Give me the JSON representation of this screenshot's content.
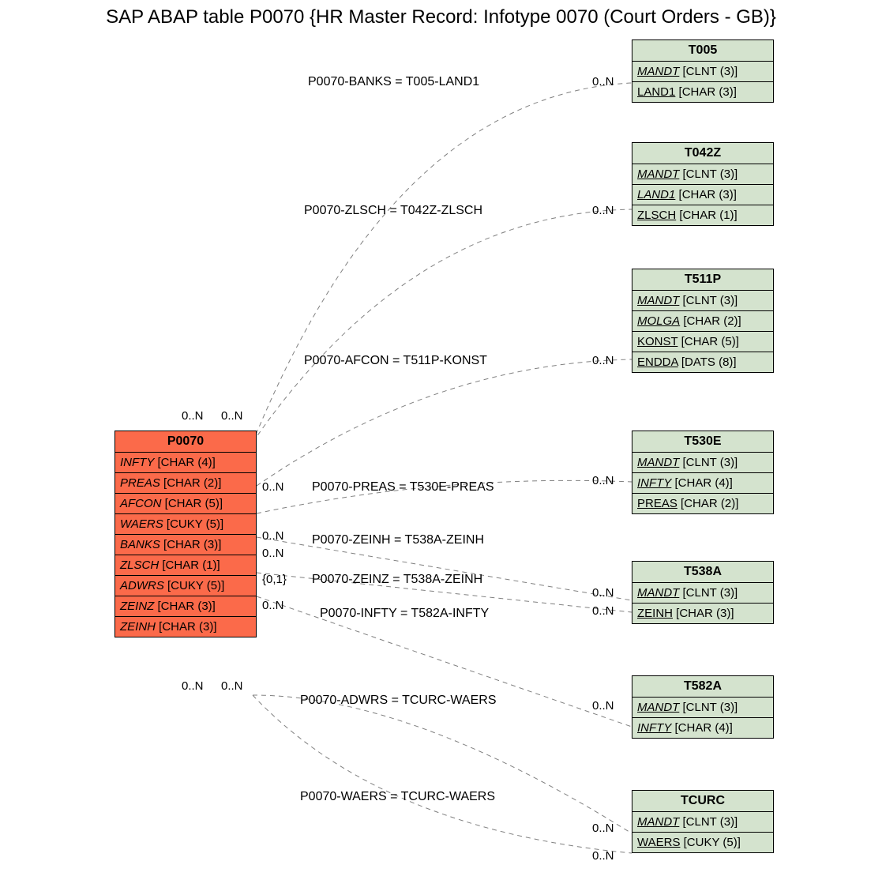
{
  "title": "SAP ABAP table P0070 {HR Master Record: Infotype 0070 (Court Orders - GB)}",
  "main_table": {
    "name": "P0070",
    "fields": [
      {
        "name": "INFTY",
        "type": "[CHAR (4)]"
      },
      {
        "name": "PREAS",
        "type": "[CHAR (2)]"
      },
      {
        "name": "AFCON",
        "type": "[CHAR (5)]"
      },
      {
        "name": "WAERS",
        "type": "[CUKY (5)]"
      },
      {
        "name": "BANKS",
        "type": "[CHAR (3)]"
      },
      {
        "name": "ZLSCH",
        "type": "[CHAR (1)]"
      },
      {
        "name": "ADWRS",
        "type": "[CUKY (5)]"
      },
      {
        "name": "ZEINZ",
        "type": "[CHAR (3)]"
      },
      {
        "name": "ZEINH",
        "type": "[CHAR (3)]"
      }
    ]
  },
  "ref_tables": [
    {
      "name": "T005",
      "fields": [
        {
          "n": "MANDT",
          "t": "[CLNT (3)]",
          "pk": 1,
          "fk": 1
        },
        {
          "n": "LAND1",
          "t": "[CHAR (3)]",
          "pk": 1
        }
      ]
    },
    {
      "name": "T042Z",
      "fields": [
        {
          "n": "MANDT",
          "t": "[CLNT (3)]",
          "pk": 1,
          "fk": 1
        },
        {
          "n": "LAND1",
          "t": "[CHAR (3)]",
          "pk": 1,
          "fk": 1
        },
        {
          "n": "ZLSCH",
          "t": "[CHAR (1)]",
          "pk": 1
        }
      ]
    },
    {
      "name": "T511P",
      "fields": [
        {
          "n": "MANDT",
          "t": "[CLNT (3)]",
          "pk": 1,
          "fk": 1
        },
        {
          "n": "MOLGA",
          "t": "[CHAR (2)]",
          "pk": 1,
          "fk": 1
        },
        {
          "n": "KONST",
          "t": "[CHAR (5)]",
          "pk": 1
        },
        {
          "n": "ENDDA",
          "t": "[DATS (8)]",
          "pk": 1
        }
      ]
    },
    {
      "name": "T530E",
      "fields": [
        {
          "n": "MANDT",
          "t": "[CLNT (3)]",
          "pk": 1,
          "fk": 1
        },
        {
          "n": "INFTY",
          "t": "[CHAR (4)]",
          "pk": 1,
          "fk": 1
        },
        {
          "n": "PREAS",
          "t": "[CHAR (2)]",
          "pk": 1
        }
      ]
    },
    {
      "name": "T538A",
      "fields": [
        {
          "n": "MANDT",
          "t": "[CLNT (3)]",
          "pk": 1,
          "fk": 1
        },
        {
          "n": "ZEINH",
          "t": "[CHAR (3)]",
          "pk": 1
        }
      ]
    },
    {
      "name": "T582A",
      "fields": [
        {
          "n": "MANDT",
          "t": "[CLNT (3)]",
          "pk": 1,
          "fk": 1
        },
        {
          "n": "INFTY",
          "t": "[CHAR (4)]",
          "pk": 1,
          "fk": 1
        }
      ]
    },
    {
      "name": "TCURC",
      "fields": [
        {
          "n": "MANDT",
          "t": "[CLNT (3)]",
          "pk": 1,
          "fk": 1
        },
        {
          "n": "WAERS",
          "t": "[CUKY (5)]",
          "pk": 1
        }
      ]
    }
  ],
  "edges": [
    {
      "label": "P0070-BANKS = T005-LAND1"
    },
    {
      "label": "P0070-ZLSCH = T042Z-ZLSCH"
    },
    {
      "label": "P0070-AFCON = T511P-KONST"
    },
    {
      "label": "P0070-PREAS = T530E-PREAS"
    },
    {
      "label": "P0070-ZEINH = T538A-ZEINH"
    },
    {
      "label": "P0070-ZEINZ = T538A-ZEINH"
    },
    {
      "label": "P0070-INFTY = T582A-INFTY"
    },
    {
      "label": "P0070-ADWRS = TCURC-WAERS"
    },
    {
      "label": "P0070-WAERS = TCURC-WAERS"
    }
  ],
  "cards": {
    "zeroN": "0..N",
    "zeroOne": "{0,1}"
  }
}
